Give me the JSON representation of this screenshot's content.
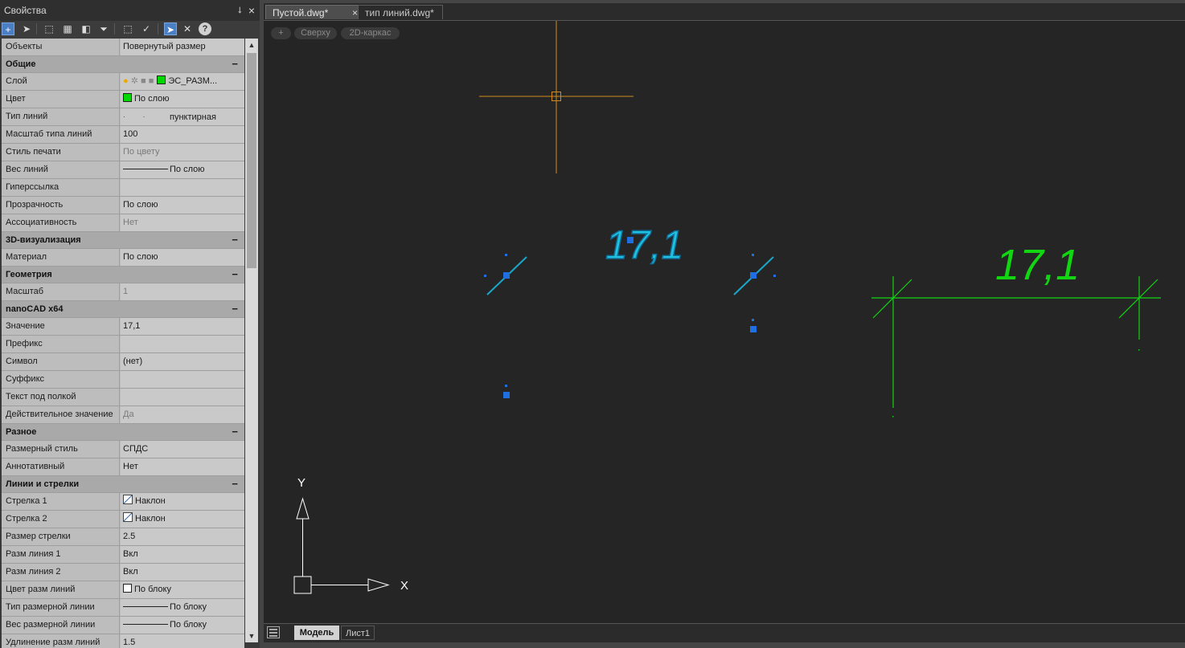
{
  "panel": {
    "title": "Свойства",
    "pin_glyph": "⭣",
    "close_glyph": "×"
  },
  "properties": [
    {
      "type": "row",
      "key": "Объекты",
      "value": "Повернутый размер"
    },
    {
      "type": "cat",
      "title": "Общие"
    },
    {
      "type": "row",
      "key": "Слой",
      "value": "ЭС_РАЗМ...",
      "swatch": "#00d800",
      "layer": true
    },
    {
      "type": "row",
      "key": "Цвет",
      "value": "По слою",
      "swatch": "#00d800"
    },
    {
      "type": "row",
      "key": "Тип линий",
      "value": "пунктирная",
      "dots": true
    },
    {
      "type": "row",
      "key": "Масштаб типа линий",
      "value": "100"
    },
    {
      "type": "row",
      "key": "Стиль печати",
      "value": "По цвету",
      "dim": true
    },
    {
      "type": "row",
      "key": "Вес линий",
      "value": "По слою",
      "line": true
    },
    {
      "type": "row",
      "key": "Гиперссылка",
      "value": ""
    },
    {
      "type": "row",
      "key": "Прозрачность",
      "value": "По слою"
    },
    {
      "type": "row",
      "key": "Ассоциативность",
      "value": "Нет",
      "dim": true
    },
    {
      "type": "cat",
      "title": "3D-визуализация"
    },
    {
      "type": "row",
      "key": "Материал",
      "value": "По слою"
    },
    {
      "type": "cat",
      "title": "Геометрия"
    },
    {
      "type": "row",
      "key": "Масштаб",
      "value": "1",
      "dim": true
    },
    {
      "type": "cat",
      "title": "nanoCAD x64"
    },
    {
      "type": "row",
      "key": "Значение",
      "value": "17,1"
    },
    {
      "type": "row",
      "key": "Префикс",
      "value": ""
    },
    {
      "type": "row",
      "key": "Символ",
      "value": "(нет)"
    },
    {
      "type": "row",
      "key": "Суффикс",
      "value": ""
    },
    {
      "type": "row",
      "key": "Текст под полкой",
      "value": ""
    },
    {
      "type": "row",
      "key": "Действительное значение",
      "value": "Да",
      "dim": true
    },
    {
      "type": "cat",
      "title": "Разное"
    },
    {
      "type": "row",
      "key": "Размерный стиль",
      "value": "СПДС"
    },
    {
      "type": "row",
      "key": "Аннотативный",
      "value": "Нет"
    },
    {
      "type": "cat",
      "title": "Линии и стрелки"
    },
    {
      "type": "row",
      "key": "Стрелка 1",
      "value": "Наклон",
      "arrow": true
    },
    {
      "type": "row",
      "key": "Стрелка 2",
      "value": "Наклон",
      "arrow": true
    },
    {
      "type": "row",
      "key": "Размер стрелки",
      "value": "2.5"
    },
    {
      "type": "row",
      "key": "Разм линия 1",
      "value": "Вкл"
    },
    {
      "type": "row",
      "key": "Разм линия 2",
      "value": "Вкл"
    },
    {
      "type": "row",
      "key": "Цвет разм линий",
      "value": "По блоку",
      "swatch": "#ffffff"
    },
    {
      "type": "row",
      "key": "Тип размерной линии",
      "value": "По блоку",
      "line": true
    },
    {
      "type": "row",
      "key": "Вес размерной линии",
      "value": "По блоку",
      "line": true
    },
    {
      "type": "row",
      "key": "Удлинение разм линий",
      "value": "1.5"
    }
  ],
  "category_collapse_glyph": "−",
  "tabs": [
    {
      "label": "Пустой.dwg*",
      "active": true
    },
    {
      "label": "тип линий.dwg*",
      "active": false
    }
  ],
  "tab_close_glyph": "×",
  "viewport": {
    "plus": "+",
    "view": "Сверху",
    "style": "2D-каркас"
  },
  "drawing": {
    "dim_text_selected": "17,1",
    "dim_text": "17,1",
    "ucs_x": "X",
    "ucs_y": "Y",
    "colors": {
      "crosshair": "#d08a1e",
      "selected_dim": "#1aa7c8",
      "grip": "#1f6fe0",
      "dim": "#11d611",
      "ucs": "#ffffff",
      "background": "#252525"
    }
  },
  "bottom": {
    "model": "Модель",
    "sheet": "Лист1"
  }
}
